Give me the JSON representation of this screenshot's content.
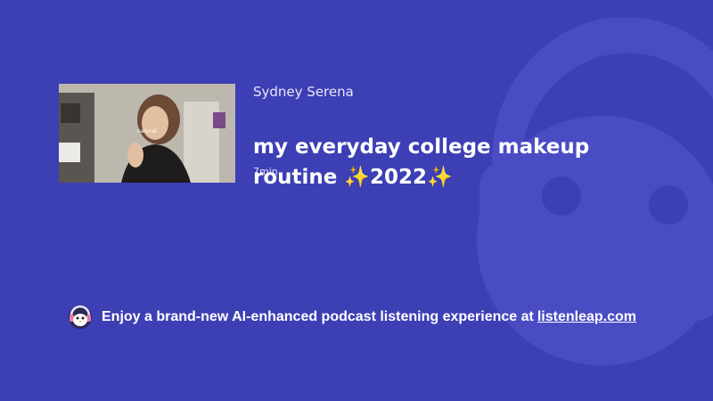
{
  "podcast": {
    "channel": "Sydney Serena",
    "title": "my everyday college makeup routine ✨2022✨",
    "duration": "7min"
  },
  "promo": {
    "text": "Enjoy a brand-new AI-enhanced podcast listening experience at",
    "link": "listenleap.com",
    "icon": "penguin-logo-icon"
  },
  "thumbnail": {
    "overlay_text": "natural",
    "icon": "video-thumbnail"
  },
  "colors": {
    "background": "#3d3fb5",
    "accent": "#4a4cc4"
  }
}
